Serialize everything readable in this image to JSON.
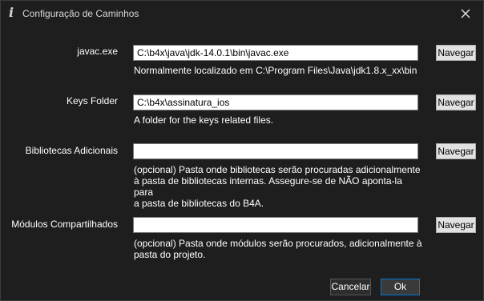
{
  "window": {
    "title": "Configuração de Caminhos",
    "icon": "info-i-icon",
    "close_icon": "close-icon"
  },
  "fields": [
    {
      "label": "javac.exe",
      "value": "C:\\b4x\\java\\jdk-14.0.1\\bin\\javac.exe",
      "browse_label": "Navegar",
      "help": "Normalmente localizado em C:\\Program Files\\Java\\jdk1.8.x_xx\\bin"
    },
    {
      "label": "Keys Folder",
      "value": "C:\\b4x\\assinatura_ios",
      "browse_label": "Navegar",
      "help": "A folder for the keys related files."
    },
    {
      "label": "Bibliotecas Adicionais",
      "value": "",
      "browse_label": "Navegar",
      "help_lines": [
        "(opcional) Pasta onde bibliotecas serão procuradas adicionalmente",
        "à pasta de bibliotecas internas. Assegure-se de NÃO aponta-la para",
        "a pasta de bibliotecas do B4A."
      ]
    },
    {
      "label": "Módulos Compartilhados",
      "value": "",
      "browse_label": "Navegar",
      "help_lines": [
        "(opcional) Pasta onde módulos serão procurados, adicionalmente à",
        "pasta do projeto."
      ]
    }
  ],
  "buttons": {
    "cancel": "Cancelar",
    "ok": "Ok"
  },
  "colors": {
    "background": "#1e1e1e",
    "ok_border_accent": "#0078d7"
  }
}
